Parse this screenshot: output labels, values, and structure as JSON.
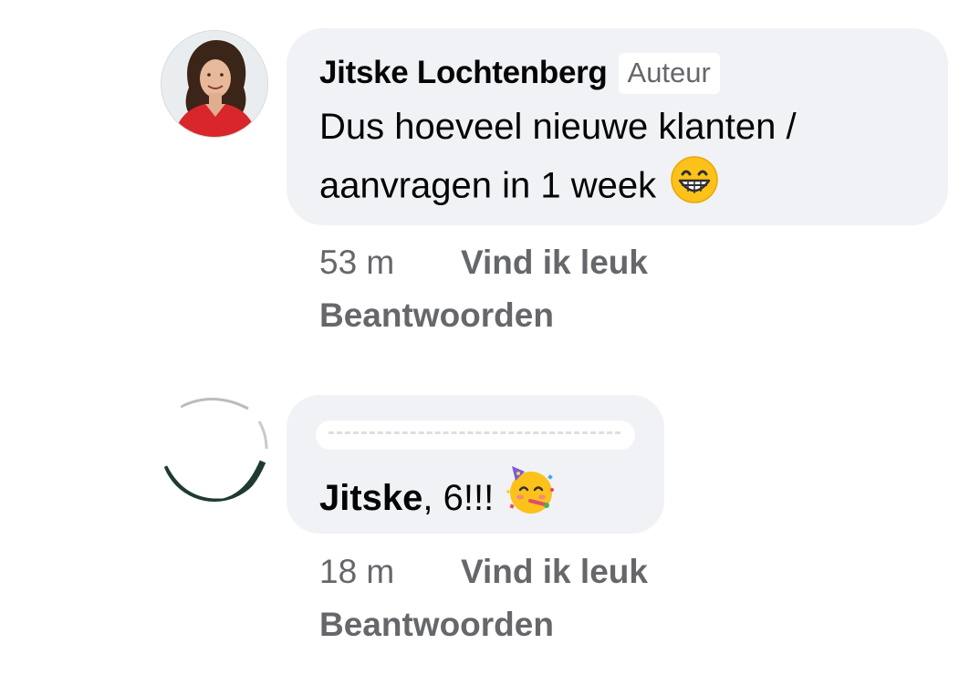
{
  "comments": [
    {
      "author": "Jitske Lochtenberg",
      "badge": "Auteur",
      "text": "Dus hoeveel nieuwe klanten / aanvragen in 1 week",
      "emoji": "grinning-face-with-smiling-eyes-emoji",
      "time": "53 m",
      "like_label": "Vind ik leuk",
      "reply_label": "Beantwoorden"
    },
    {
      "author": "",
      "mention": "Jitske",
      "text": ", 6!!!",
      "emoji": "partying-face-emoji",
      "time": "18 m",
      "like_label": "Vind ik leuk",
      "reply_label": "Beantwoorden"
    }
  ],
  "colors": {
    "bubble_bg": "#f0f2f5",
    "text": "#050505",
    "meta_text": "#65676b"
  }
}
